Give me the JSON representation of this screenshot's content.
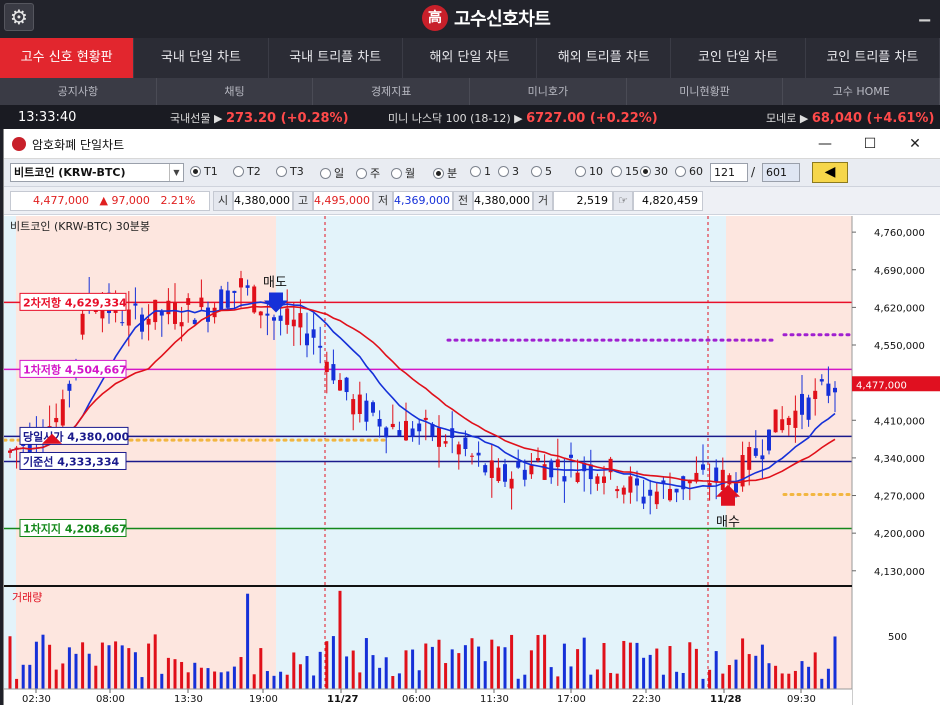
{
  "app": {
    "gear_icon": "gear-icon",
    "brand_mark": "高",
    "brand_name": "고수신호차트"
  },
  "tabs_main": [
    {
      "label": "고수 신호 현황판",
      "active": true
    },
    {
      "label": "국내 단일 차트"
    },
    {
      "label": "국내 트리플 차트"
    },
    {
      "label": "해외 단일 차트"
    },
    {
      "label": "해외 트리플 차트"
    },
    {
      "label": "코인 단일 차트"
    },
    {
      "label": "코인 트리플 차트"
    }
  ],
  "tabs_sub": [
    "공지사항",
    "채팅",
    "경제지표",
    "미니호가",
    "미니현황판",
    "고수 HOME"
  ],
  "ticker": {
    "time": "13:33:40",
    "items": [
      {
        "label": "국내선물 ▶",
        "value": "273.20 (+0.28%)"
      },
      {
        "label": "미니 나스닥 100 (18-12) ▶",
        "value": "6727.00 (+0.22%)"
      },
      {
        "label": "모네로 ▶",
        "value": "68,040 (+4.61%)"
      }
    ]
  },
  "window": {
    "title": "암호화폐 단일차트",
    "minimize": "—",
    "maximize": "☐",
    "close": "✕"
  },
  "toolbar": {
    "symbol": "비트코인 (KRW-BTC)",
    "radios": [
      {
        "label": "T1",
        "on": true
      },
      {
        "label": "T2",
        "on": false
      },
      {
        "label": "T3",
        "on": false
      },
      {
        "label": "일",
        "on": false
      },
      {
        "label": "주",
        "on": false
      },
      {
        "label": "월",
        "on": false
      },
      {
        "label": "분",
        "on": true
      },
      {
        "label": "1",
        "on": false
      },
      {
        "label": "3",
        "on": false
      },
      {
        "label": "5",
        "on": false
      },
      {
        "label": "10",
        "on": false
      },
      {
        "label": "15",
        "on": false
      },
      {
        "label": "30",
        "on": true
      },
      {
        "label": "60",
        "on": false
      }
    ],
    "count_value": "121",
    "slash": "/",
    "count_total": "601",
    "back_label": "◀"
  },
  "quote": {
    "price": "4,477,000",
    "change": "▲ 97,000",
    "change_pct": "2.21%",
    "open_label": "시",
    "open": "4,380,000",
    "high_label": "고",
    "high": "4,495,000",
    "low_label": "저",
    "low": "4,369,000",
    "prev_label": "전",
    "prev": "4,380,000",
    "vol_label": "거",
    "vol": "2,519",
    "amt_label": "☞",
    "amt": "4,820,459"
  },
  "chart_data": {
    "type": "candlestick",
    "title": "비트코인 (KRW-BTC)  30분봉",
    "price_axis_ticks": [
      "4,760,000",
      "4,690,000",
      "4,620,000",
      "4,550,000",
      "4,480,000",
      "4,410,000",
      "4,340,000",
      "4,270,000",
      "4,200,000",
      "4,130,000"
    ],
    "price_axis_values": [
      4760000,
      4690000,
      4620000,
      4550000,
      4480000,
      4410000,
      4340000,
      4270000,
      4200000,
      4130000
    ],
    "ylim": [
      4111000,
      4790000
    ],
    "current_price_label": "4,477,000",
    "current_price": 4477000,
    "time_axis_labels": [
      "02:30",
      "08:00",
      "13:30",
      "19:00",
      "11/27",
      "06:00",
      "11:30",
      "17:00",
      "22:30",
      "11/28",
      "09:30"
    ],
    "levels": [
      {
        "label": "2차저항",
        "value_label": "4,629,334",
        "value": 4629334,
        "color": "#e8102a"
      },
      {
        "label": "1차저항",
        "value_label": "4,504,667",
        "value": 4504667,
        "color": "#d416c8"
      },
      {
        "label": "당일시가",
        "value_label": "4,380,000",
        "value": 4380000,
        "color": "#1a1a8c"
      },
      {
        "label": "기준선",
        "value_label": "4,333,334",
        "value": 4333334,
        "color": "#1a1a8c"
      },
      {
        "label": "1차지지",
        "value_label": "4,208,667",
        "value": 4208667,
        "color": "#13881a"
      }
    ],
    "signals": [
      {
        "label": "매도",
        "type": "sell"
      },
      {
        "label": "매수",
        "type": "buy"
      }
    ],
    "volume_label": "거래량",
    "volume_tick": "500",
    "grid": false,
    "colors": {
      "up": "#e0101a",
      "down": "#1530d8",
      "ma_short": "#e0101a",
      "ma_long": "#1530d8"
    }
  }
}
